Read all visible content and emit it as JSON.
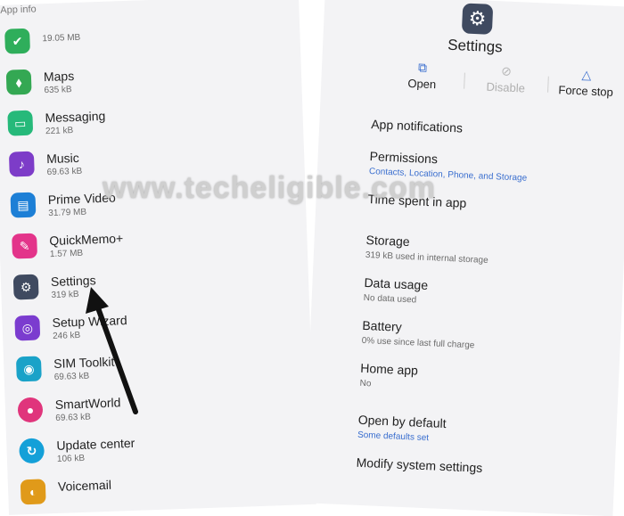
{
  "left_screen": {
    "header": "App info",
    "apps": [
      {
        "name": "",
        "size": "19.05 MB",
        "icon": "green-app-icon",
        "color": "#2fae5b"
      },
      {
        "name": "Maps",
        "size": "635 kB",
        "icon": "maps-icon",
        "color": "#34a853"
      },
      {
        "name": "Messaging",
        "size": "221 kB",
        "icon": "messaging-icon",
        "color": "#26b97a"
      },
      {
        "name": "Music",
        "size": "69.63 kB",
        "icon": "music-icon",
        "color": "#7d3cc8"
      },
      {
        "name": "Prime Video",
        "size": "31.79 MB",
        "icon": "prime-video-icon",
        "color": "#1d7fd6"
      },
      {
        "name": "QuickMemo+",
        "size": "1.57 MB",
        "icon": "quickmemo-icon",
        "color": "#e3348a"
      },
      {
        "name": "Settings",
        "size": "319 kB",
        "icon": "gear-icon",
        "color": "#3f4a60"
      },
      {
        "name": "Setup Wizard",
        "size": "246 kB",
        "icon": "setup-wizard-icon",
        "color": "#7b3ccf"
      },
      {
        "name": "SIM Toolkit",
        "size": "69.63 kB",
        "icon": "sim-toolkit-icon",
        "color": "#1aa2c8"
      },
      {
        "name": "SmartWorld",
        "size": "69.63 kB",
        "icon": "smartworld-icon",
        "color": "#e0357c"
      },
      {
        "name": "Update center",
        "size": "106 kB",
        "icon": "update-center-icon",
        "color": "#14a0d8"
      },
      {
        "name": "Voicemail",
        "size": "",
        "icon": "voicemail-icon",
        "color": "#e09a1a"
      }
    ]
  },
  "right_screen": {
    "title": "Settings",
    "actions": {
      "open": "Open",
      "disable": "Disable",
      "force_stop": "Force stop"
    },
    "items": [
      {
        "title": "App notifications",
        "sub": ""
      },
      {
        "title": "Permissions",
        "sub": "Contacts, Location, Phone, and Storage"
      },
      {
        "title": "Time spent in app",
        "sub": ""
      },
      {
        "title": "Storage",
        "sub": "319 kB used in internal storage"
      },
      {
        "title": "Data usage",
        "sub": "No data used"
      },
      {
        "title": "Battery",
        "sub": "0% use since last full charge"
      },
      {
        "title": "Home app",
        "sub": "No"
      },
      {
        "title": "Open by default",
        "sub": "Some defaults set"
      },
      {
        "title": "Modify system settings",
        "sub": ""
      }
    ]
  },
  "watermark": "www.techeligible.com",
  "colors": {
    "accent_blue": "#3b6fcf",
    "arrow": "#111111"
  }
}
